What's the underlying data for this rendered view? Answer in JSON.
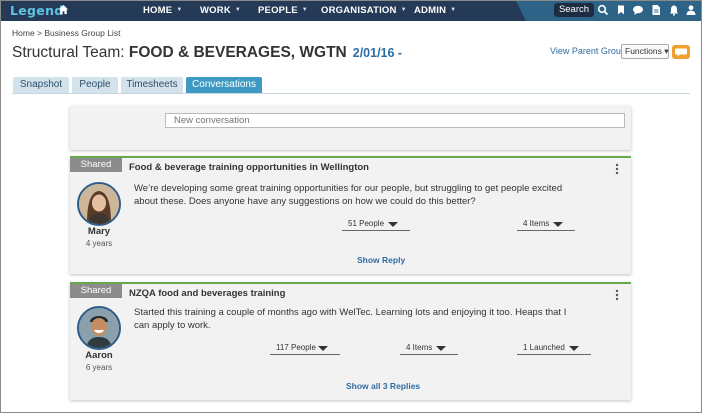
{
  "nav": {
    "logo": "Legend",
    "items": [
      {
        "label": "HOME"
      },
      {
        "label": "WORK"
      },
      {
        "label": "PEOPLE"
      },
      {
        "label": "ORGANISATION"
      },
      {
        "label": "ADMIN"
      }
    ],
    "search_label": "Search"
  },
  "header": {
    "breadcrumb": "Home > Business Group List",
    "title_prefix": "Structural Team: ",
    "title_name": "FOOD & BEVERAGES, WGTN",
    "title_date": "2/01/16 -",
    "view_parent": "View Parent Group",
    "functions": "Functions ▾"
  },
  "tabs": [
    {
      "label": "Snapshot",
      "active": false
    },
    {
      "label": "People",
      "active": false
    },
    {
      "label": "Timesheets",
      "active": false
    },
    {
      "label": "Conversations",
      "active": true
    }
  ],
  "composer": {
    "placeholder": "New conversation"
  },
  "posts": [
    {
      "badge": "Shared",
      "title": "Food & beverage training opportunities in Wellington",
      "author": "Mary",
      "age": "4 years",
      "body": "We’re developing some great training opportunities for our people, but struggling to get people excited about these. Does anyone have any suggestions on how we could do this better?",
      "dropdowns": [
        "51 People",
        "4 Items"
      ],
      "reply_link": "Show Reply"
    },
    {
      "badge": "Shared",
      "title": "NZQA food and beverages training",
      "author": "Aaron",
      "age": "6 years",
      "body": "Started this training a couple of months ago with WelTec.  Learning lots and enjoying it too. Heaps that I can apply to work.",
      "dropdowns": [
        "117 People",
        "4 Items",
        "1 Launched"
      ],
      "reply_link": "Show all 3 Replies"
    }
  ],
  "colors": {
    "nav_bg": "#243a57",
    "accent": "#3f9ac3",
    "link": "#2e6da4",
    "shared_border": "#6aa84f"
  },
  "icons": [
    "home-icon",
    "search-icon",
    "flag-icon",
    "chat-bubble-icon",
    "document-icon",
    "bell-icon",
    "user-icon",
    "kebab-menu-icon",
    "chat-icon"
  ]
}
